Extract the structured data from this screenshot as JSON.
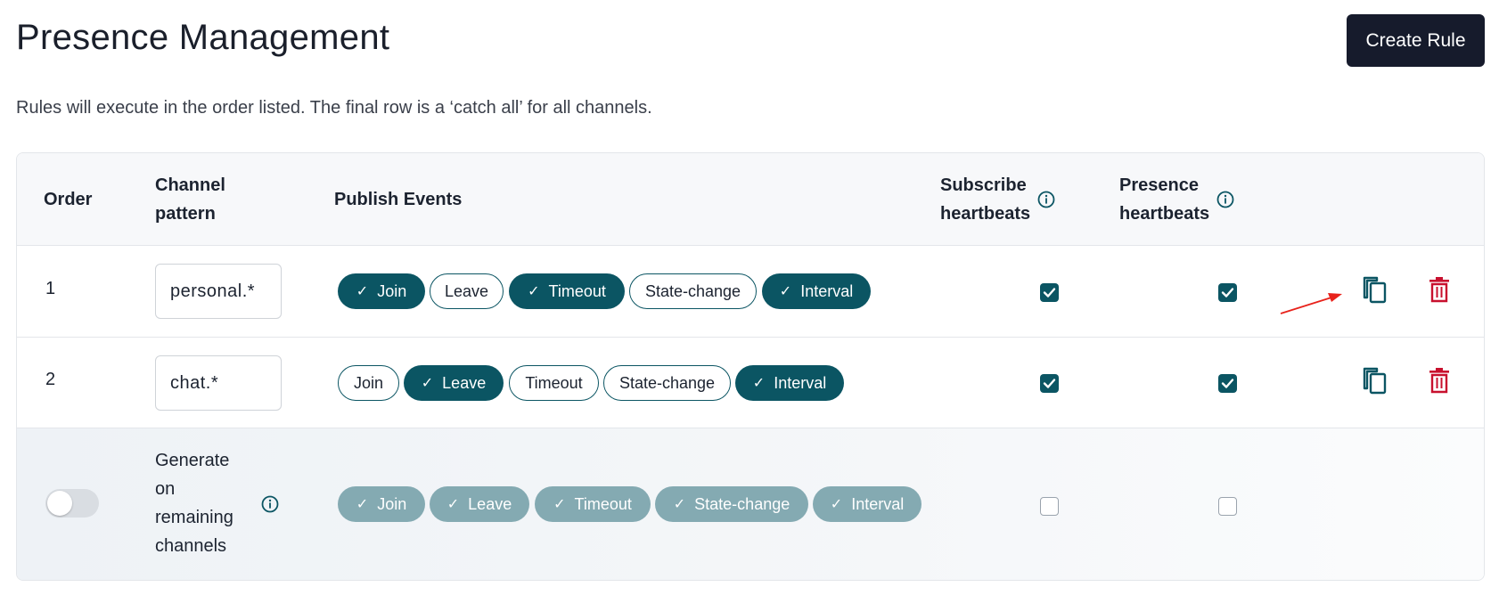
{
  "header": {
    "title": "Presence Management",
    "create_label": "Create Rule",
    "subtitle": "Rules will execute in the order listed. The final row is a ‘catch all’ for all channels."
  },
  "columns": {
    "order": "Order",
    "channel_line1": "Channel",
    "channel_line2": "pattern",
    "publish": "Publish Events",
    "subscribe_line1": "Subscribe",
    "subscribe_line2": "heartbeats",
    "presence_line1": "Presence",
    "presence_line2": "heartbeats"
  },
  "rows": [
    {
      "order": "1",
      "pattern": "personal.*",
      "events": [
        {
          "label": "Join",
          "on": true
        },
        {
          "label": "Leave",
          "on": false
        },
        {
          "label": "Timeout",
          "on": true
        },
        {
          "label": "State-change",
          "on": false
        },
        {
          "label": "Interval",
          "on": true
        }
      ],
      "subscribe": true,
      "presence": true
    },
    {
      "order": "2",
      "pattern": "chat.*",
      "events": [
        {
          "label": "Join",
          "on": false
        },
        {
          "label": "Leave",
          "on": true
        },
        {
          "label": "Timeout",
          "on": false
        },
        {
          "label": "State-change",
          "on": false
        },
        {
          "label": "Interval",
          "on": true
        }
      ],
      "subscribe": true,
      "presence": true
    }
  ],
  "catch_all": {
    "label_line1": "Generate",
    "label_line2": "on",
    "label_line3": "remaining",
    "label_line4": "channels",
    "enabled": false,
    "events": [
      {
        "label": "Join",
        "on": true
      },
      {
        "label": "Leave",
        "on": true
      },
      {
        "label": "Timeout",
        "on": true
      },
      {
        "label": "State-change",
        "on": true
      },
      {
        "label": "Interval",
        "on": true
      }
    ],
    "subscribe": false,
    "presence": false
  },
  "colors": {
    "accent": "#0b5563",
    "accent_dim": "#84aab2",
    "button_dark": "#161b2c",
    "delete_red": "#c8102e",
    "annotation_arrow": "#e8221b"
  },
  "icons": {
    "copy": "copy-icon",
    "delete": "trash-icon",
    "info": "info-icon",
    "check": "check-icon"
  }
}
